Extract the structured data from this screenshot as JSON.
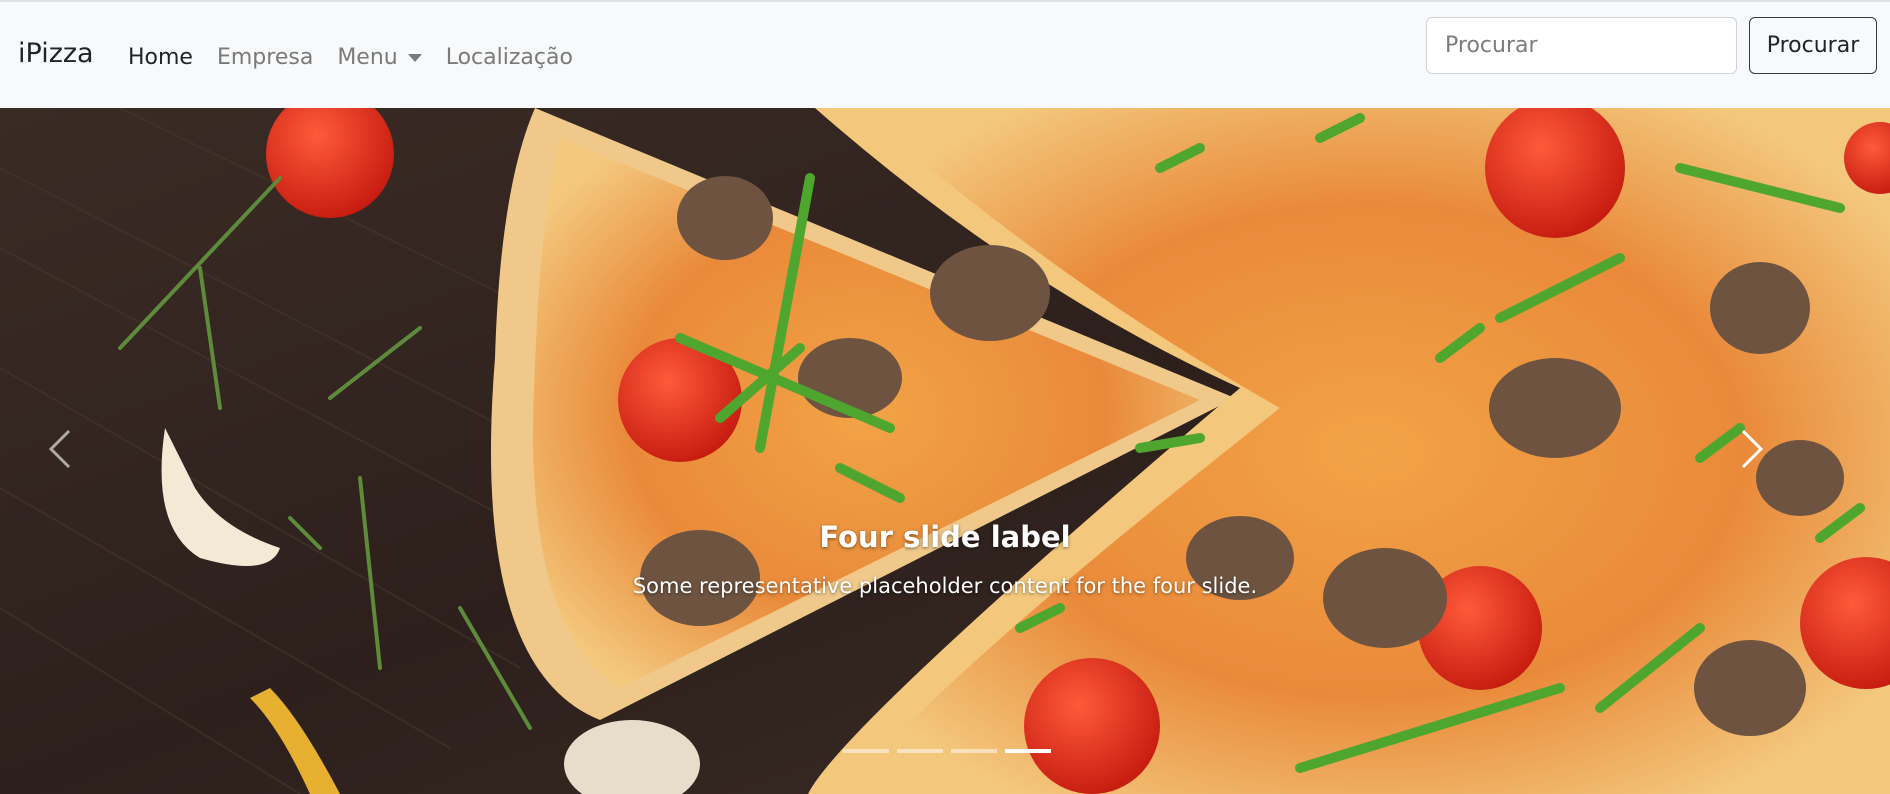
{
  "navbar": {
    "brand": "iPizza",
    "links": [
      {
        "label": "Home",
        "active": true
      },
      {
        "label": "Empresa",
        "active": false
      },
      {
        "label": "Menu",
        "active": false,
        "dropdown": true
      },
      {
        "label": "Localização",
        "active": false
      }
    ],
    "search": {
      "placeholder": "Procurar",
      "value": "",
      "button_label": "Procurar"
    }
  },
  "carousel": {
    "active_index": 3,
    "slide_count": 4,
    "caption_title": "Four slide label",
    "caption_text": "Some representative placeholder content for the four slide."
  },
  "colors": {
    "navbar_bg": "#f8f9fa",
    "text_dark": "#212529",
    "text_muted": "#7a7a7a",
    "caption": "#ffffff"
  }
}
